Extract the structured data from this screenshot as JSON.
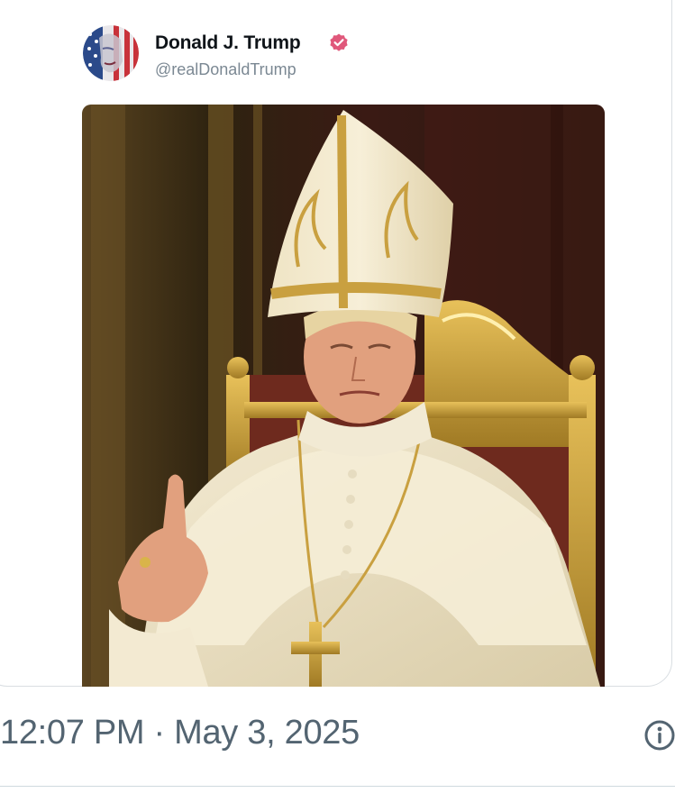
{
  "post": {
    "author": {
      "name": "Donald J. Trump",
      "handle": "@realDonaldTrump",
      "avatar_icon": "american-flag-portrait",
      "verified_icon": "verified-badge-icon"
    },
    "media": {
      "description_icon": "pope-portrait-image"
    },
    "timestamp": "12:07 PM · May 3, 2025",
    "info_icon": "info-icon"
  },
  "colors": {
    "name": "#0f1419",
    "handle": "#7b8893",
    "timestamp": "#536471",
    "verified": "#e0587b",
    "border": "#d9dee2"
  }
}
